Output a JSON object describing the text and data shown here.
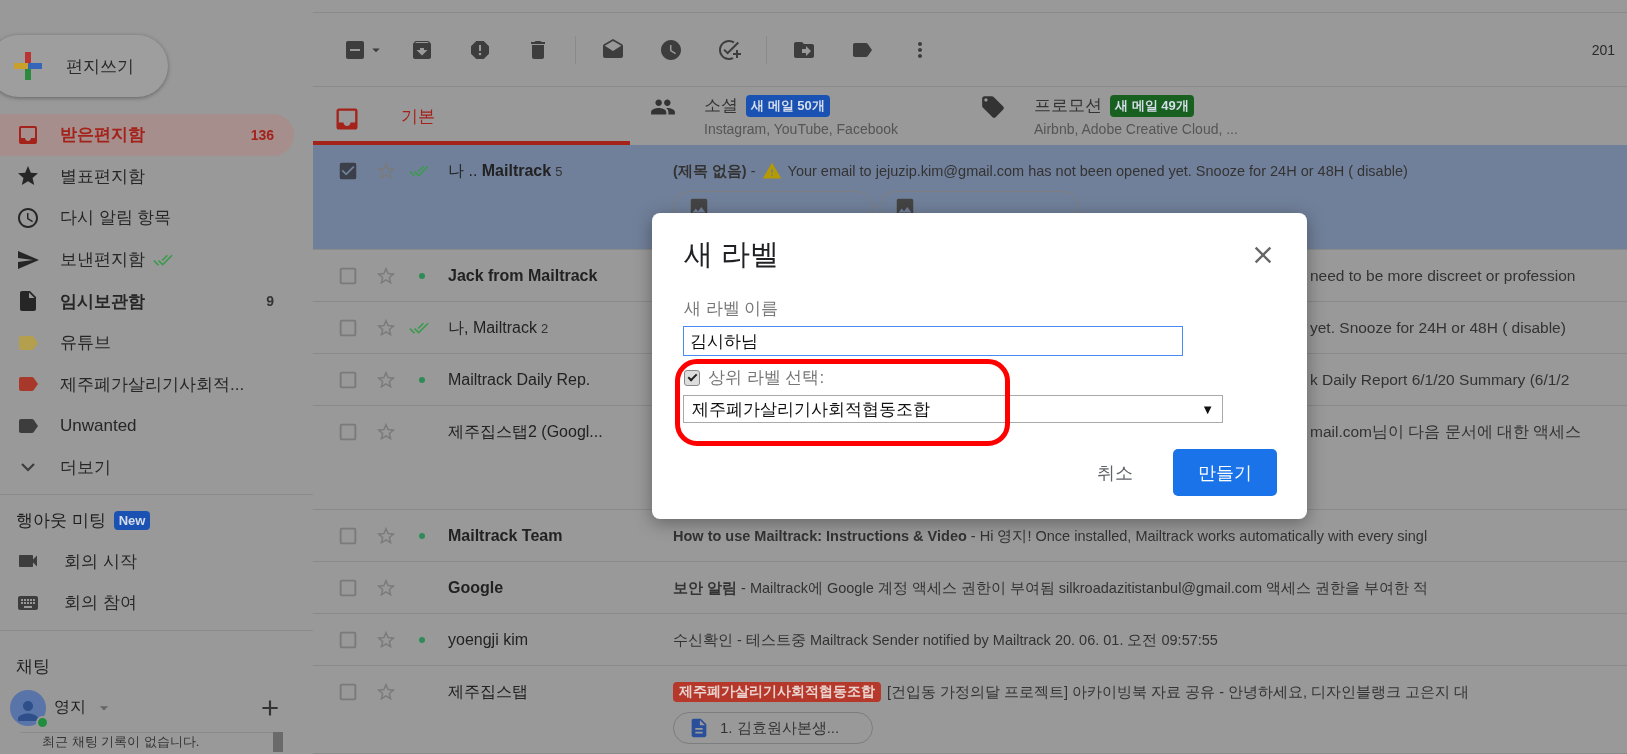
{
  "toolbar": {
    "date_partial": "201",
    "some_selected": true
  },
  "compose": {
    "label": "편지쓰기"
  },
  "folders": [
    {
      "kind": "inbox",
      "label": "받은편지함",
      "count": "136",
      "selected": true,
      "bold": true
    },
    {
      "kind": "starred",
      "label": "별표편지함",
      "selected": false,
      "bold": false
    },
    {
      "kind": "snoozed",
      "label": "다시 알림 항목",
      "selected": false,
      "bold": false
    },
    {
      "kind": "sent",
      "label": "보낸편지함",
      "selected": false,
      "bold": false
    },
    {
      "kind": "drafts",
      "label": "임시보관함",
      "count": "9",
      "selected": false,
      "bold": true
    },
    {
      "kind": "label",
      "label": "유튜브",
      "color": "#b49f4e",
      "selected": false,
      "bold": false
    },
    {
      "kind": "label",
      "label": "제주폐가살리기사회적...",
      "color": "#a8382a",
      "selected": false,
      "bold": false
    },
    {
      "kind": "label",
      "label": "Unwanted",
      "color": "#3d3d3d",
      "selected": false,
      "bold": false
    },
    {
      "kind": "more",
      "label": "더보기",
      "selected": false,
      "bold": false
    }
  ],
  "meet": {
    "title": "행아웃 미팅",
    "badge": "New",
    "items": [
      {
        "kind": "video",
        "label": "회의 시작"
      },
      {
        "kind": "keyboard",
        "label": "회의 참여"
      }
    ]
  },
  "chat": {
    "title": "채팅",
    "user": "영지",
    "empty_text": "최근 채팅 기록이 없습니다."
  },
  "tabs": [
    {
      "kind": "primary",
      "label": "기본",
      "selected": true
    },
    {
      "kind": "social",
      "label": "소셜",
      "badge": "새 메일 50개",
      "color": "#1a52b4",
      "subtitle": "Instagram, YouTube, Facebook",
      "selected": false
    },
    {
      "kind": "promotions",
      "label": "프로모션",
      "badge": "새 메일 49개",
      "color": "#17601f",
      "subtitle": "Airbnb, Adobe Creative Cloud, ...",
      "selected": false
    }
  ],
  "rows": [
    {
      "kind": "full",
      "selected": true,
      "checked": true,
      "starred": false,
      "unread": false,
      "new_dot": false,
      "seen_check": true,
      "sender": "나 .. **Mailtrack**",
      "count": "5",
      "line": "**(제목 없음)** -",
      "alert": true,
      "line_after": "Your email to jejuzip.kim@gmail.com has not been opened yet. Snooze for 24H or 48H ( disable)",
      "chips": [
        {
          "kind": "image"
        },
        {
          "kind": "image"
        }
      ]
    },
    {
      "kind": "covered",
      "selected": false,
      "checked": false,
      "starred": false,
      "unread": true,
      "new_dot": true,
      "seen_check": false,
      "sender": "Jack from Mailtrack",
      "tail": "need to be more discreet or profession"
    },
    {
      "kind": "covered",
      "selected": false,
      "checked": false,
      "starred": false,
      "unread": false,
      "new_dot": false,
      "seen_check": true,
      "sender": "나, Mailtrack",
      "count": "2",
      "tail": "yet. Snooze for 24H or 48H ( disable)"
    },
    {
      "kind": "covered",
      "selected": false,
      "checked": false,
      "starred": false,
      "unread": false,
      "new_dot": true,
      "seen_check": false,
      "sender": "Mailtrack Daily Rep.",
      "tail": "k Daily Report 6/1/20 Summary (6/1/2"
    },
    {
      "kind": "covered",
      "tall": true,
      "selected": false,
      "checked": false,
      "starred": false,
      "unread": false,
      "new_dot": false,
      "seen_check": false,
      "sender": "제주집스탭2 (Googl...",
      "tail": "mail.com님이 다음 문서에 대한 액세스"
    },
    {
      "kind": "full",
      "selected": false,
      "checked": false,
      "starred": false,
      "unread": true,
      "new_dot": true,
      "seen_check": false,
      "sender": "Mailtrack Team",
      "line": "**How to use Mailtrack: Instructions & Video** - Hi 영지! Once installed, Mailtrack works automatically with every singl",
      "alert": false
    },
    {
      "kind": "full",
      "selected": false,
      "checked": false,
      "starred": false,
      "unread": true,
      "new_dot": false,
      "seen_check": false,
      "sender": "Google",
      "line": "**보안 알림** - Mailtrack에 Google 계정 액세스 권한이 부여됨 silkroadazitistanbul@gmail.com 액세스 권한을 부여한 적",
      "alert": false
    },
    {
      "kind": "full",
      "selected": false,
      "checked": false,
      "starred": false,
      "unread": false,
      "new_dot": true,
      "seen_check": false,
      "sender": "yoengji kim",
      "line": "수신확인 - 테스트중 Mailtrack Sender notified by Mailtrack 20. 06. 01. 오전 09:57:55",
      "alert": false
    },
    {
      "kind": "full",
      "selected": false,
      "checked": false,
      "starred": false,
      "unread": false,
      "new_dot": false,
      "seen_check": false,
      "sender": "제주집스탭",
      "tag": {
        "text": "제주폐가살리기사회적협동조합",
        "color": "#b5382a"
      },
      "line": "[건입동 가정의달 프로젝트] 아카이빙북 자료 공유 - 안녕하세요, 디자인블랭크 고은지 대",
      "alert": false,
      "chips": [
        {
          "kind": "doc",
          "text": "1. 김효원사본생..."
        }
      ]
    }
  ],
  "dialog": {
    "title": "새 라벨",
    "name_label": "새 라벨 이름",
    "name_value": "김시하님",
    "parent_label": "상위 라벨 선택:",
    "parent_checked": true,
    "parent_value": "제주폐가살리기사회적협동조합",
    "select_arrow": "▼",
    "cancel": "취소",
    "create": "만들기"
  }
}
